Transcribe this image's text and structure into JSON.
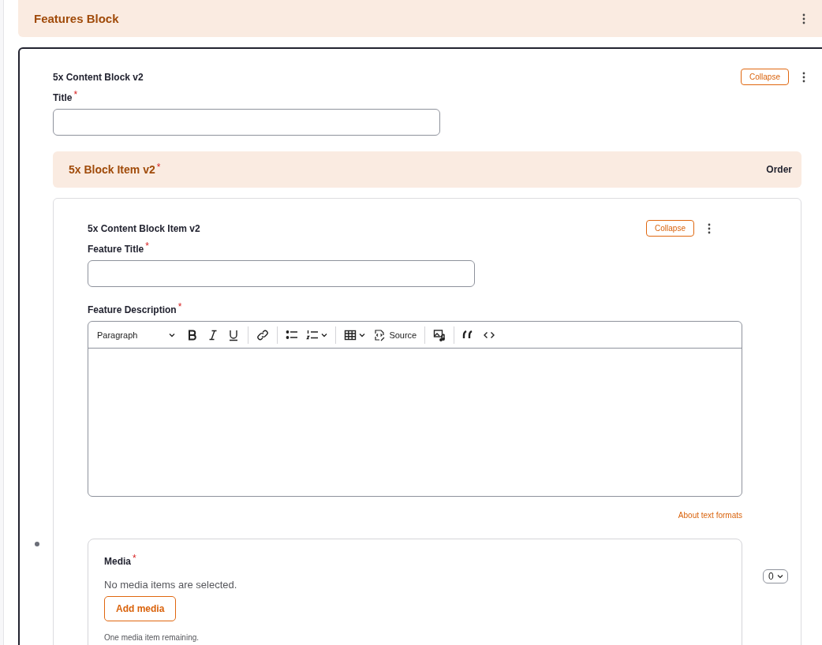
{
  "features_block": {
    "title": "Features Block"
  },
  "content_block": {
    "heading": "5x Content Block v2",
    "collapse_button": "Collapse",
    "title_field": {
      "label": "Title",
      "required_mark": "*"
    },
    "block_items": {
      "title": "5x Block Item v2",
      "required_mark": "*",
      "order_label": "Order",
      "item": {
        "heading": "5x Content Block Item v2",
        "collapse_button": "Collapse",
        "feature_title": {
          "label": "Feature Title",
          "required_mark": "*"
        },
        "feature_description": {
          "label": "Feature Description",
          "required_mark": "*",
          "format": "Paragraph",
          "source_label": "Source",
          "help_link": "About text formats"
        },
        "media": {
          "label": "Media",
          "required_mark": "*",
          "empty_text": "No media items are selected.",
          "add_button": "Add media",
          "remaining_text": "One media item remaining."
        },
        "weight": "0"
      }
    }
  }
}
